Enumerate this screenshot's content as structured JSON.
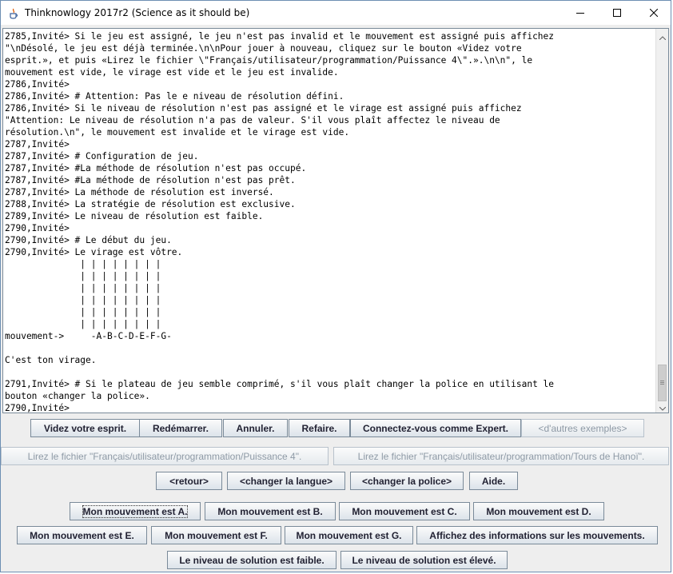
{
  "window": {
    "title": "Thinknowlogy 2017r2 (Science as it should be)"
  },
  "console": {
    "lines": [
      "2785,Invité> Si le jeu est assigné, le jeu n'est pas invalid et le mouvement est assigné puis affichez",
      "\"\\nDésolé, le jeu est déjà terminée.\\n\\nPour jouer à nouveau, cliquez sur le bouton «Videz votre",
      "esprit.», et puis «Lirez le fichier \\\"Français/utilisateur/programmation/Puissance 4\\\".».\\n\\n\", le",
      "mouvement est vide, le virage est vide et le jeu est invalide.",
      "2786,Invité>",
      "2786,Invité> # Attention: Pas le e niveau de résolution défini.",
      "2786,Invité> Si le niveau de résolution n'est pas assigné et le virage est assigné puis affichez",
      "\"Attention: Le niveau de résolution n'a pas de valeur. S'il vous plaît affectez le niveau de",
      "résolution.\\n\", le mouvement est invalide et le virage est vide.",
      "2787,Invité>",
      "2787,Invité> # Configuration de jeu.",
      "2787,Invité> #La méthode de résolution n'est pas occupé.",
      "2787,Invité> #La méthode de résolution n'est pas prêt.",
      "2787,Invité> La méthode de résolution est inversé.",
      "2788,Invité> La stratégie de résolution est exclusive.",
      "2789,Invité> Le niveau de résolution est faible.",
      "2790,Invité>",
      "2790,Invité> # Le début du jeu.",
      "2790,Invité> Le virage est vôtre.",
      "              | | | | | | | |",
      "              | | | | | | | |",
      "              | | | | | | | |",
      "              | | | | | | | |",
      "              | | | | | | | |",
      "              | | | | | | | |",
      "mouvement->     -A-B-C-D-E-F-G-",
      "",
      "C'est ton virage.",
      "",
      "2791,Invité> # Si le plateau de jeu semble comprimé, s'il vous plaît changer la police en utilisant le",
      "bouton «changer la police».",
      "2790,Invité>"
    ]
  },
  "buttons": {
    "row1": [
      {
        "label": "Videz votre esprit.",
        "enabled": true
      },
      {
        "label": "Redémarrer.",
        "enabled": true
      },
      {
        "label": "Annuler.",
        "enabled": true
      },
      {
        "label": "Refaire.",
        "enabled": true
      },
      {
        "label": "Connectez-vous comme Expert.",
        "enabled": true
      },
      {
        "label": "<d'autres exemples>",
        "enabled": false
      }
    ],
    "row2": [
      {
        "label": "Lirez le fichier \"Français/utilisateur/programmation/Puissance 4\".",
        "enabled": false
      },
      {
        "label": "Lirez le fichier \"Français/utilisateur/programmation/Tours de Hanoï\".",
        "enabled": false
      }
    ],
    "row3": [
      {
        "label": "<retour>",
        "enabled": true
      },
      {
        "label": "<changer la langue>",
        "enabled": true
      },
      {
        "label": "<changer la police>",
        "enabled": true
      },
      {
        "label": "Aide.",
        "enabled": true
      }
    ],
    "row4": [
      {
        "label": "Mon mouvement est A.",
        "enabled": true
      },
      {
        "label": "Mon mouvement est B.",
        "enabled": true
      },
      {
        "label": "Mon mouvement est C.",
        "enabled": true
      },
      {
        "label": "Mon mouvement est D.",
        "enabled": true
      }
    ],
    "row5": [
      {
        "label": "Mon mouvement est E.",
        "enabled": true
      },
      {
        "label": "Mon mouvement est F.",
        "enabled": true
      },
      {
        "label": "Mon mouvement est G.",
        "enabled": true
      },
      {
        "label": "Affichez des informations sur les mouvements.",
        "enabled": true
      }
    ],
    "row6": [
      {
        "label": "Le niveau de solution est faible.",
        "enabled": true
      },
      {
        "label": "Le niveau de solution est élevé.",
        "enabled": true
      }
    ]
  },
  "icons": {
    "app": "java-cup-icon",
    "minimize": "minimize-icon",
    "maximize": "maximize-icon",
    "close": "close-icon"
  }
}
